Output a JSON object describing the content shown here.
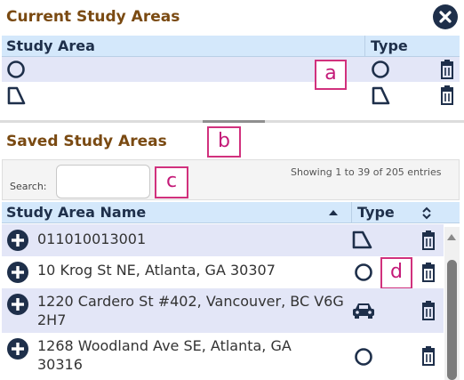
{
  "current": {
    "title": "Current Study Areas",
    "col_study_area": "Study Area",
    "col_type": "Type",
    "rows": [
      {
        "icon": "circle-icon",
        "type_icon": "circle-icon"
      },
      {
        "icon": "polygon-icon",
        "type_icon": "polygon-icon"
      }
    ]
  },
  "saved": {
    "title": "Saved Study Areas",
    "search_label": "Search:",
    "search_value": "",
    "entries_info": "Showing 1 to 39 of 205 entries",
    "col_name": "Study Area Name",
    "col_type": "Type",
    "rows": [
      {
        "name": "011010013001",
        "type_icon": "polygon-icon"
      },
      {
        "name": "10 Krog St NE, Atlanta, GA 30307",
        "type_icon": "circle-icon"
      },
      {
        "name": "1220 Cardero St #402, Vancouver, BC V6G 2H7",
        "type_icon": "car-icon"
      },
      {
        "name": "1268 Woodland Ave SE, Atlanta, GA 30316",
        "type_icon": "circle-icon"
      }
    ]
  },
  "annotations": {
    "a": "a",
    "b": "b",
    "c": "c",
    "d": "d"
  },
  "colors": {
    "header_bg": "#d4e8fb",
    "row_alt": "#e3e6f7",
    "title": "#7a4a12",
    "icon": "#1e2f4a",
    "annotation": "#d1317d"
  }
}
